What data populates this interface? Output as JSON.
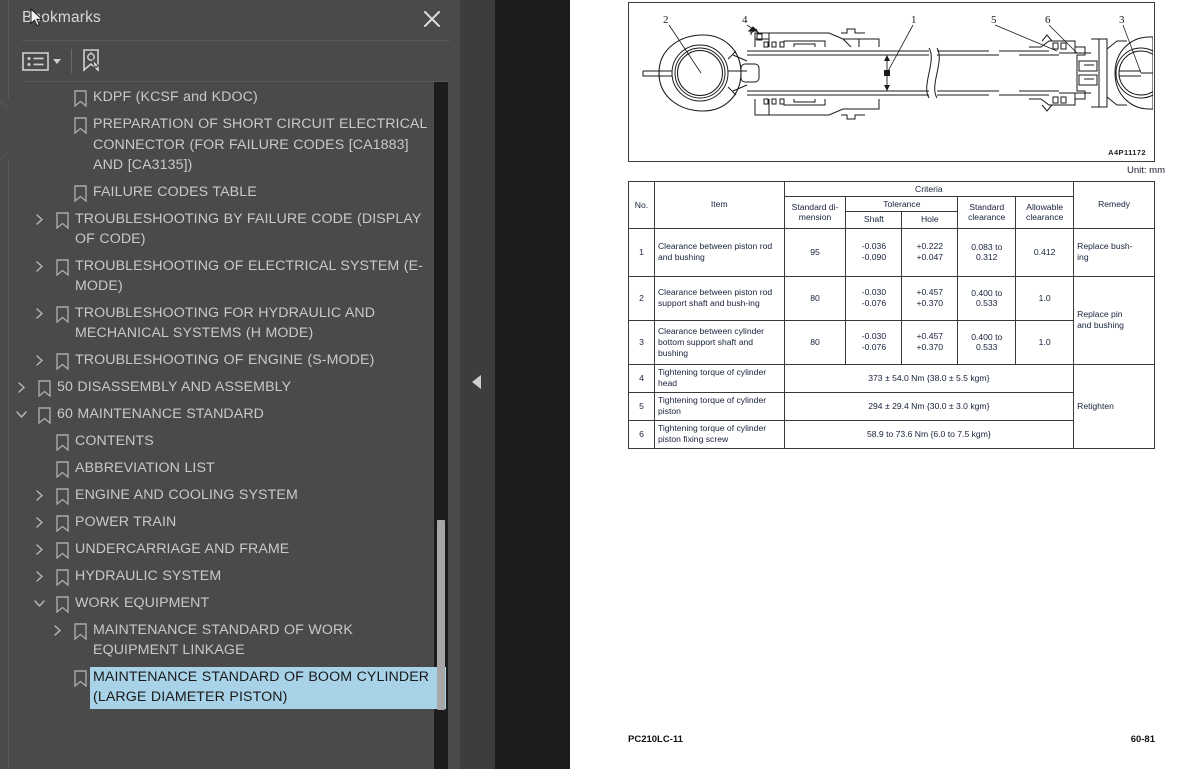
{
  "sidebar": {
    "title": "Bookmarks",
    "close_icon": "close-icon",
    "toolbar": {
      "options_icon": "list-options-icon",
      "new_bookmark_icon": "new-bookmark-icon"
    },
    "tree": [
      {
        "label": "KDPF (KCSF and KDOC)",
        "level": 2,
        "twisty": "none",
        "selected": false
      },
      {
        "label": "PREPARATION OF SHORT CIRCUIT ELECTRICAL CONNECTOR (FOR FAILURE CODES [CA1883] AND [CA3135])",
        "level": 2,
        "twisty": "none",
        "selected": false
      },
      {
        "label": "FAILURE CODES TABLE",
        "level": 2,
        "twisty": "none",
        "selected": false
      },
      {
        "label": "TROUBLESHOOTING BY FAILURE CODE (DISPLAY OF CODE)",
        "level": 1,
        "twisty": "collapsed",
        "selected": false
      },
      {
        "label": "TROUBLESHOOTING OF ELECTRICAL SYSTEM (E-MODE)",
        "level": 1,
        "twisty": "collapsed",
        "selected": false
      },
      {
        "label": "TROUBLESHOOTING FOR HYDRAULIC AND MECHANICAL SYSTEMS (H MODE)",
        "level": 1,
        "twisty": "collapsed",
        "selected": false
      },
      {
        "label": "TROUBLESHOOTING OF ENGINE (S-MODE)",
        "level": 1,
        "twisty": "collapsed",
        "selected": false
      },
      {
        "label": "50 DISASSEMBLY AND ASSEMBLY",
        "level": 0,
        "twisty": "collapsed",
        "selected": false
      },
      {
        "label": "60 MAINTENANCE STANDARD",
        "level": 0,
        "twisty": "expanded",
        "selected": false
      },
      {
        "label": "CONTENTS",
        "level": 1,
        "twisty": "none",
        "selected": false
      },
      {
        "label": "ABBREVIATION LIST",
        "level": 1,
        "twisty": "none",
        "selected": false
      },
      {
        "label": "ENGINE AND COOLING SYSTEM",
        "level": 1,
        "twisty": "collapsed",
        "selected": false
      },
      {
        "label": "POWER TRAIN",
        "level": 1,
        "twisty": "collapsed",
        "selected": false
      },
      {
        "label": "UNDERCARRIAGE AND FRAME",
        "level": 1,
        "twisty": "collapsed",
        "selected": false
      },
      {
        "label": "HYDRAULIC SYSTEM",
        "level": 1,
        "twisty": "collapsed",
        "selected": false
      },
      {
        "label": "WORK EQUIPMENT",
        "level": 1,
        "twisty": "expanded",
        "selected": false
      },
      {
        "label": "MAINTENANCE STANDARD OF WORK EQUIPMENT LINKAGE",
        "level": 2,
        "twisty": "collapsed",
        "selected": false
      },
      {
        "label": "MAINTENANCE STANDARD OF BOOM CYLINDER (LARGE DIAMETER PISTON)",
        "level": 2,
        "twisty": "none",
        "selected": true
      }
    ],
    "selection_color": "#a8d2e8"
  },
  "collapse_handle": {
    "icon": "collapse-left-triangle-icon"
  },
  "document": {
    "figure": {
      "id_label": "A4P11172",
      "callouts": [
        "2",
        "4",
        "1",
        "5",
        "6",
        "3"
      ],
      "description": "hydraulic-boom-cylinder-cross-section"
    },
    "unit_label": "Unit: mm",
    "table": {
      "headers": {
        "no": "No.",
        "item": "Item",
        "criteria": "Criteria",
        "remedy": "Remedy",
        "standard_dimension": "Standard di-\nmension",
        "tolerance": "Tolerance",
        "shaft": "Shaft",
        "hole": "Hole",
        "standard_clearance": "Standard\nclearance",
        "allowable_clearance": "Allowable\nclearance"
      },
      "rows": [
        {
          "no": "1",
          "item": "Clearance between piston rod and bushing",
          "standard_dimension": "95",
          "shaft_upper": "-0.036",
          "shaft_lower": "-0.090",
          "hole_upper": "+0.222",
          "hole_lower": "+0.047",
          "standard_clearance": "0.083 to 0.312",
          "allowable_clearance": "0.412",
          "remedy": "Replace bush-\ning"
        },
        {
          "no": "2",
          "item": "Clearance between piston rod support shaft and bush-ing",
          "standard_dimension": "80",
          "shaft_upper": "-0.030",
          "shaft_lower": "-0.076",
          "hole_upper": "+0.457",
          "hole_lower": "+0.370",
          "standard_clearance": "0.400 to 0.533",
          "allowable_clearance": "1.0",
          "remedy": "Replace pin and bushing"
        },
        {
          "no": "3",
          "item": "Clearance between cylinder bottom support shaft and bushing",
          "standard_dimension": "80",
          "shaft_upper": "-0.030",
          "shaft_lower": "-0.076",
          "hole_upper": "+0.457",
          "hole_lower": "+0.370",
          "standard_clearance": "0.400 to 0.533",
          "allowable_clearance": "1.0",
          "remedy": ""
        },
        {
          "no": "4",
          "item": "Tightening torque of cylinder head",
          "torque": "373 ± 54.0 Nm {38.0 ± 5.5 kgm}",
          "remedy": ""
        },
        {
          "no": "5",
          "item": "Tightening torque of cylinder piston",
          "torque": "294 ± 29.4 Nm {30.0 ± 3.0 kgm}",
          "remedy": "Retighten"
        },
        {
          "no": "6",
          "item": "Tightening torque of cylinder piston fixing screw",
          "torque": "58.9 to 73.6 Nm {6.0 to 7.5 kgm}",
          "remedy": ""
        }
      ]
    },
    "footer": {
      "model": "PC210LC-11",
      "page": "60-81"
    }
  }
}
